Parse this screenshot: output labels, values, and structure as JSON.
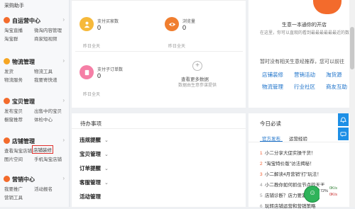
{
  "sidebar": {
    "top_link": "采购助手",
    "groups": [
      {
        "title": "自运营中心",
        "icon": "megaphone-icon",
        "rows": [
          [
            "淘宝直播",
            "微淘内容管理"
          ],
          [
            "淘宝群",
            "商家短视频"
          ]
        ]
      },
      {
        "title": "物流管理",
        "icon": "truck-icon",
        "rows": [
          [
            "发货",
            "物流工具"
          ],
          [
            "物流服务",
            "我要寄快递"
          ]
        ]
      },
      {
        "title": "宝贝管理",
        "icon": "tag-icon",
        "rows": [
          [
            "发布宝贝",
            "出售中的宝贝"
          ],
          [
            "橱窗推荐",
            "体检中心"
          ]
        ]
      },
      {
        "title": "店铺管理",
        "icon": "shop-icon",
        "rows": [
          [
            "查看淘宝店铺",
            "店铺装修"
          ],
          [
            "图片空间",
            "手机淘宝店铺"
          ]
        ]
      },
      {
        "title": "营销中心",
        "icon": "coin-icon",
        "rows": [
          [
            "我要推广",
            "活动报名"
          ],
          [
            "营销工具",
            ""
          ]
        ]
      }
    ]
  },
  "stats": [
    {
      "label": "支付买家数",
      "value": "0",
      "compare": "昨日全天",
      "icon": "buyer-icon",
      "color": "#f6b93b"
    },
    {
      "label": "浏览量",
      "value": "0",
      "compare": "昨日全天",
      "icon": "eye-icon",
      "color": "#f07e2f"
    },
    {
      "label": "支付子订单数",
      "value": "0",
      "compare": "昨日全天",
      "icon": "order-icon",
      "color": "#f57fa6"
    }
  ],
  "more_data": {
    "title": "查看更多数据",
    "sub": "数据由生意参谋提供"
  },
  "todo": {
    "title": "待办事项",
    "items": [
      "违规提醒",
      "宝贝管理",
      "订单提醒",
      "客服管理",
      "活动管理"
    ]
  },
  "business": {
    "title": "生意一本通你的开店",
    "line1": "在这里，你可以直观的看到最最最最最最近的数据",
    "notice": "暂时没有相关生意经推荐，您可以前往",
    "links": [
      "店铺装修",
      "营销活动",
      "淘货源",
      "物流管理",
      "行业社区",
      "商友互助"
    ]
  },
  "must_read": {
    "title": "今日必读",
    "tabs": [
      "官方发布",
      "运营经验"
    ],
    "news": [
      "小二分享大促实操干货！",
      "\"淘宝特价版\"访法揭秘！",
      "小二解读4月营销\"打\"玩法！",
      "小二教你如何抓住节点的天天",
      "店铺诊断？店力要素有哪些？",
      "玩转店铺运营和营销策略"
    ]
  },
  "colors": {
    "accent": "#1a70c9",
    "alert": "#e0302c",
    "float": "#1d8fe6"
  },
  "network": {
    "up": "0K/s",
    "down": "0K/s",
    "pct": "72%"
  }
}
